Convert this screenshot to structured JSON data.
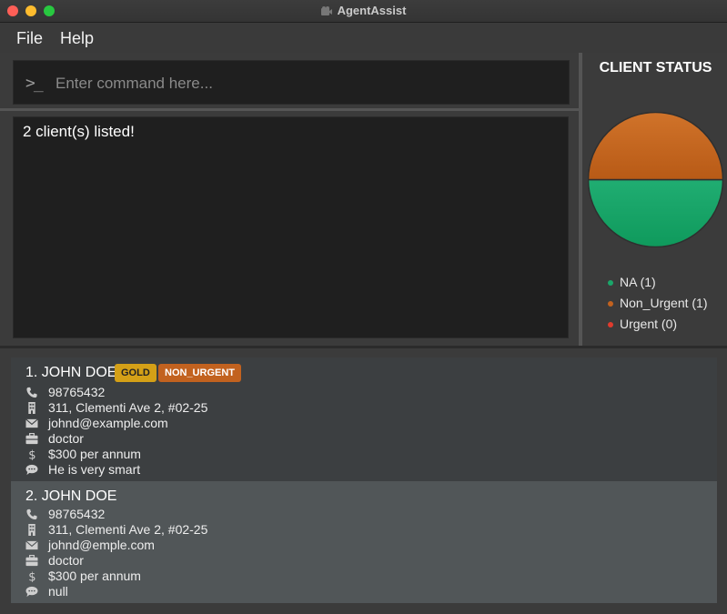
{
  "window": {
    "title": "AgentAssist"
  },
  "menu": {
    "items": [
      "File",
      "Help"
    ]
  },
  "command": {
    "placeholder": "Enter command here...",
    "value": ""
  },
  "result": {
    "text": "2 client(s) listed!"
  },
  "status_panel": {
    "title": "CLIENT STATUS",
    "legend": [
      {
        "label": "NA (1)",
        "color": "#1aa66a"
      },
      {
        "label": "Non_Urgent (1)",
        "color": "#c2621f"
      },
      {
        "label": "Urgent (0)",
        "color": "#e03b2d"
      }
    ]
  },
  "chart_data": {
    "type": "pie",
    "series": [
      {
        "name": "NA",
        "value": 1,
        "color": "#1aa66a"
      },
      {
        "name": "Non_Urgent",
        "value": 1,
        "color": "#c2621f"
      },
      {
        "name": "Urgent",
        "value": 0,
        "color": "#e03b2d"
      }
    ]
  },
  "clients": [
    {
      "name": "1. JOHN DOE",
      "tags": [
        "GOLD",
        "NON_URGENT"
      ],
      "phone": "98765432",
      "address": "311, Clementi Ave 2, #02-25",
      "email": "johnd@example.com",
      "occupation": "doctor",
      "income": "$300 per annum",
      "remark": "He is very smart"
    },
    {
      "name": "2. JOHN DOE",
      "tags": [],
      "phone": "98765432",
      "address": "311, Clementi Ave 2, #02-25",
      "email": "johnd@emple.com",
      "occupation": "doctor",
      "income": "$300 per annum",
      "remark": "null"
    }
  ],
  "icons": {
    "phone": "phone-icon",
    "address": "building-icon",
    "email": "envelope-icon",
    "occupation": "briefcase-icon",
    "income": "dollar-icon",
    "remark": "speech-bubble-icon"
  }
}
